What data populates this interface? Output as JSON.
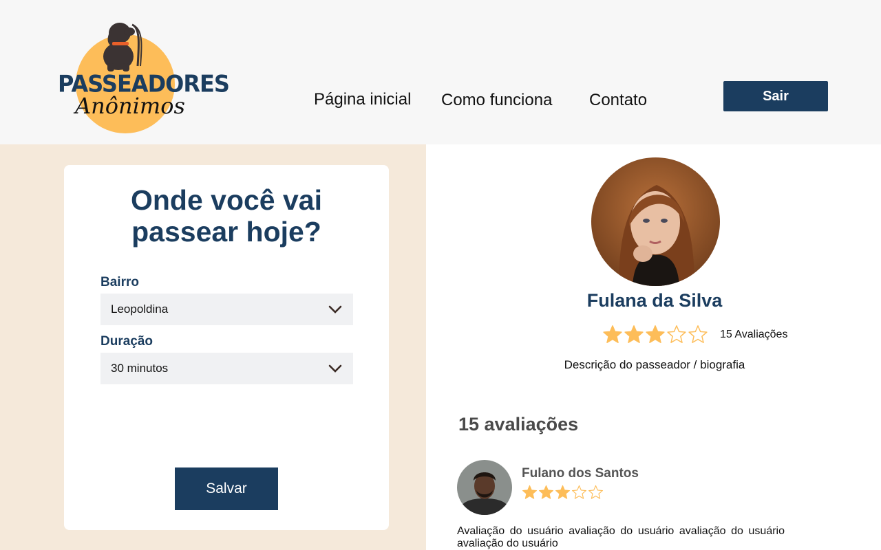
{
  "colors": {
    "primary": "#1b3d5f",
    "logo_circle": "#fdbd59",
    "panel_bg": "#f5e9da",
    "header_bg": "#f7f7f7",
    "star": "#fdbd59",
    "dog": "#3b3333",
    "collar": "#e8602a"
  },
  "header": {
    "logo": {
      "title": "PASSEADORES",
      "subtitle": "Anônimos",
      "icon": "dog-with-leash-icon"
    },
    "nav": [
      {
        "label": "Página inicial"
      },
      {
        "label": "Como funciona"
      },
      {
        "label": "Contato"
      }
    ],
    "logout_label": "Sair"
  },
  "form": {
    "title_line1": "Onde você vai",
    "title_line2": "passear hoje?",
    "neighborhood": {
      "label": "Bairro",
      "value": "Leopoldina",
      "icon": "chevron-down-icon"
    },
    "duration": {
      "label": "Duração",
      "value": "30 minutos",
      "icon": "chevron-down-icon"
    },
    "save_label": "Salvar"
  },
  "walker": {
    "name": "Fulana da Silva",
    "rating": 3,
    "rating_max": 5,
    "rating_count_text": "15 Avaliações",
    "bio": "Descrição do passeador / biografia"
  },
  "reviews": {
    "title": "15 avaliações",
    "items": [
      {
        "name": "Fulano dos Santos",
        "rating": 3,
        "rating_max": 5,
        "text": "Avaliação do usuário avaliação do usuário avaliação do usuário avaliação do usuário"
      }
    ]
  }
}
